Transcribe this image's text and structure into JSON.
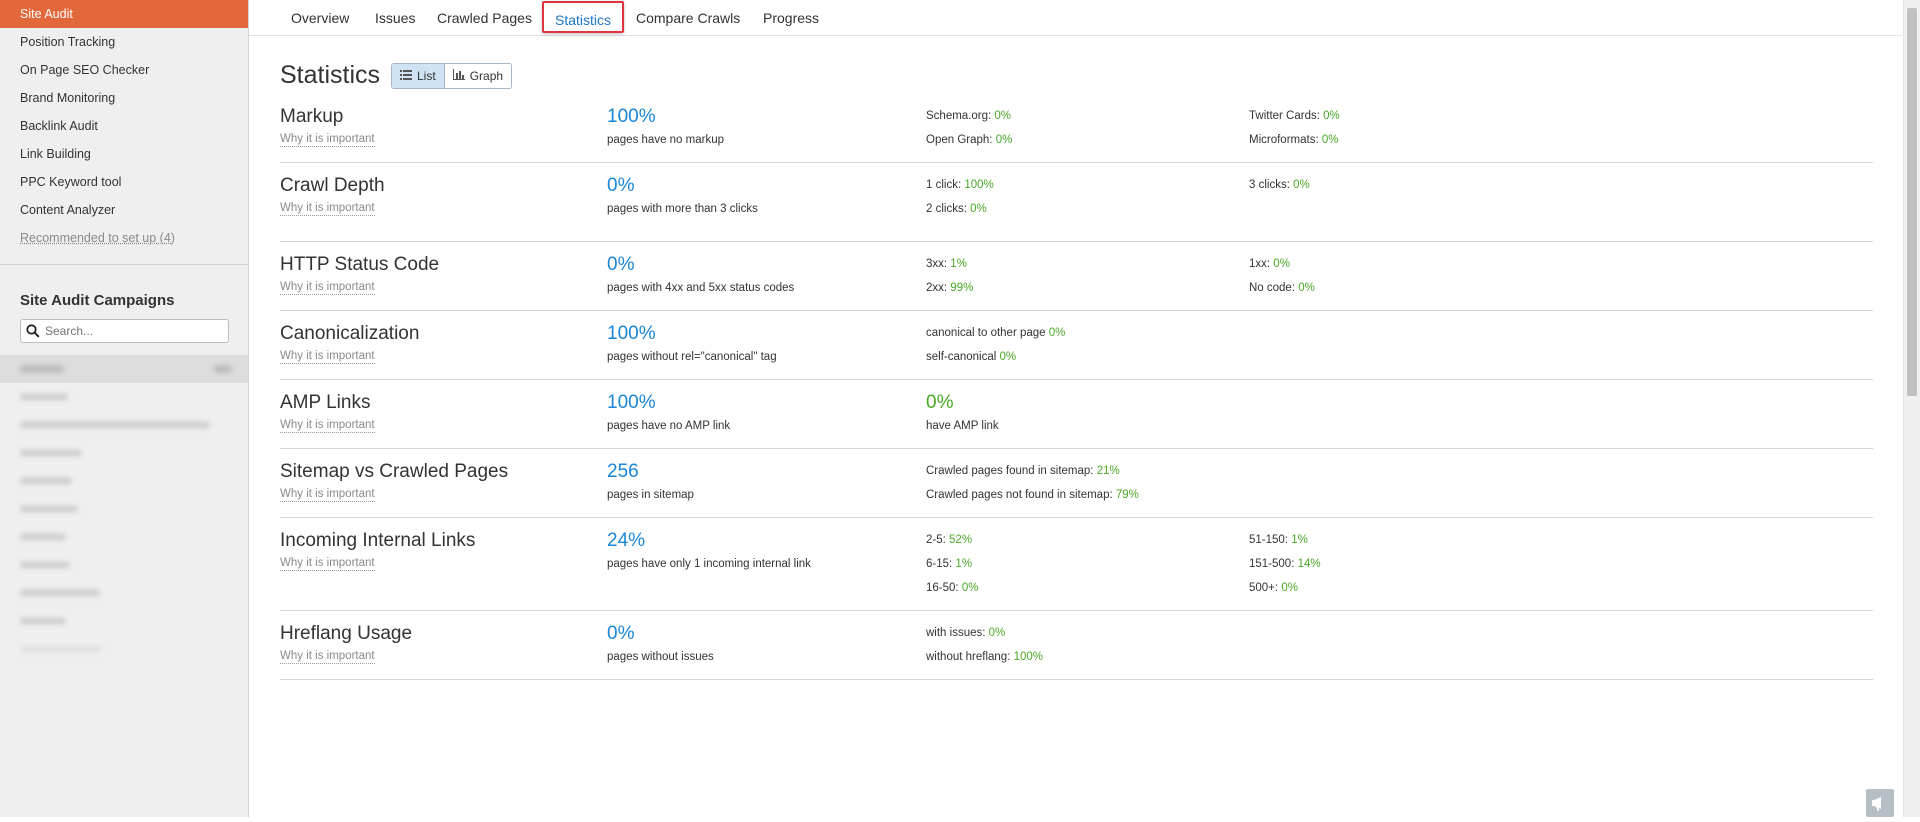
{
  "sidebar": {
    "items": [
      {
        "label": "Site Audit",
        "active": true
      },
      {
        "label": "Position Tracking"
      },
      {
        "label": "On Page SEO Checker"
      },
      {
        "label": "Brand Monitoring"
      },
      {
        "label": "Backlink Audit"
      },
      {
        "label": "Link Building"
      },
      {
        "label": "PPC Keyword tool"
      },
      {
        "label": "Content Analyzer"
      },
      {
        "label": "Recommended to set up (4)",
        "muted": true
      }
    ],
    "campaigns_title": "Site Audit Campaigns",
    "search_placeholder": "Search..."
  },
  "tabs": [
    "Overview",
    "Issues",
    "Crawled Pages",
    "Statistics",
    "Compare Crawls",
    "Progress"
  ],
  "active_tab": "Statistics",
  "page": {
    "title": "Statistics",
    "view_list": "List",
    "view_graph": "Graph",
    "why_label": "Why it is important"
  },
  "stats": [
    {
      "title": "Markup",
      "value": "100%",
      "desc": "pages have no markup",
      "col1": [
        {
          "k": "Schema.org:",
          "v": "0%"
        },
        {
          "k": "Open Graph:",
          "v": "0%"
        }
      ],
      "col2": [
        {
          "k": "Twitter Cards:",
          "v": "0%"
        },
        {
          "k": "Microformats:",
          "v": "0%"
        }
      ]
    },
    {
      "title": "Crawl Depth",
      "value": "0%",
      "desc": "pages with more than 3 clicks",
      "col1": [
        {
          "k": "1 click:",
          "v": "100%"
        },
        {
          "k": "2 clicks:",
          "v": "0%"
        }
      ],
      "col2": [
        {
          "k": "3 clicks:",
          "v": "0%"
        }
      ]
    },
    {
      "title": "HTTP Status Code",
      "value": "0%",
      "desc": "pages with 4xx and 5xx status codes",
      "col1": [
        {
          "k": "3xx:",
          "v": "1%"
        },
        {
          "k": "2xx:",
          "v": "99%"
        }
      ],
      "col2": [
        {
          "k": "1xx:",
          "v": "0%"
        },
        {
          "k": "No code:",
          "v": "0%"
        }
      ]
    },
    {
      "title": "Canonicalization",
      "value": "100%",
      "desc": "pages without rel=\"canonical\" tag",
      "col1": [
        {
          "k": "canonical to other page",
          "v": "0%"
        },
        {
          "k": "self-canonical",
          "v": "0%"
        }
      ],
      "col2": []
    },
    {
      "title": "AMP Links",
      "value": "100%",
      "desc": "pages have no AMP link",
      "second_value": "0%",
      "second_desc": "have AMP link"
    },
    {
      "title": "Sitemap vs Crawled Pages",
      "value": "256",
      "desc": "pages in sitemap",
      "col1": [
        {
          "k": "Crawled pages found in sitemap:",
          "v": "21%"
        },
        {
          "k": "Crawled pages not found in sitemap:",
          "v": "79%"
        }
      ],
      "col2": []
    },
    {
      "title": "Incoming Internal Links",
      "value": "24%",
      "desc": "pages have only 1 incoming internal link",
      "col1": [
        {
          "k": "2-5:",
          "v": "52%"
        },
        {
          "k": "6-15:",
          "v": "1%"
        },
        {
          "k": "16-50:",
          "v": "0%"
        }
      ],
      "col2": [
        {
          "k": "51-150:",
          "v": "1%"
        },
        {
          "k": "151-500:",
          "v": "14%"
        },
        {
          "k": "500+:",
          "v": "0%"
        }
      ]
    },
    {
      "title": "Hreflang Usage",
      "value": "0%",
      "desc": "pages without issues",
      "col1": [
        {
          "k": "with issues:",
          "v": "0%"
        },
        {
          "k": "without hreflang:",
          "v": "100%"
        }
      ],
      "col2": []
    }
  ],
  "colors": {
    "accent": "#e2673a",
    "blue": "#1a86d6",
    "green": "#49a925",
    "highlight": "#e0343f"
  }
}
